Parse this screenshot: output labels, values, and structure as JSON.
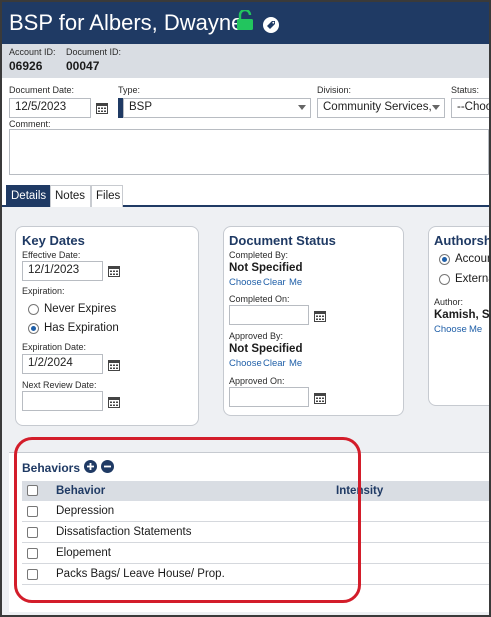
{
  "header": {
    "title": "BSP for Albers, Dwayne",
    "account_id_label": "Account ID:",
    "account_id": "06926",
    "document_id_label": "Document ID:",
    "document_id": "00047",
    "lock_color": "#22c55e"
  },
  "form": {
    "document_date_label": "Document Date:",
    "document_date": "12/5/2023",
    "type_label": "Type:",
    "type_value": "BSP",
    "division_label": "Division:",
    "division_value": "Community Services,",
    "status_label": "Status:",
    "status_value": "--Choo",
    "comment_label": "Comment:"
  },
  "tabs": [
    {
      "label": "Details",
      "active": true
    },
    {
      "label": "Notes",
      "active": false
    },
    {
      "label": "Files",
      "active": false
    }
  ],
  "key_dates": {
    "title": "Key Dates",
    "effective_label": "Effective Date:",
    "effective_value": "12/1/2023",
    "expiration_label": "Expiration:",
    "never_expires": "Never Expires",
    "has_expiration": "Has Expiration",
    "expiration_date_label": "Expiration Date:",
    "expiration_date_value": "1/2/2024",
    "next_review_label": "Next Review Date:"
  },
  "document_status": {
    "title": "Document Status",
    "completed_by_label": "Completed By:",
    "completed_by_value": "Not Specified",
    "completed_links": [
      "Choose",
      "Clear",
      "Me"
    ],
    "completed_on_label": "Completed On:",
    "approved_by_label": "Approved By:",
    "approved_by_value": "Not Specified",
    "approved_links": [
      "Choose",
      "Clear",
      "Me"
    ],
    "approved_on_label": "Approved On:"
  },
  "authorship": {
    "title": "Authorshi",
    "option1": "Accoun",
    "option2": "Externa",
    "author_label": "Author:",
    "author_value": "Kamish, Sc",
    "links": [
      "Choose",
      "Me"
    ]
  },
  "behaviors": {
    "title": "Behaviors",
    "col_behavior": "Behavior",
    "col_intensity": "Intensity",
    "rows": [
      "Depression",
      "Dissatisfaction Statements",
      "Elopement",
      "Packs Bags/ Leave House/ Prop."
    ],
    "highlight_color": "#d31d2a"
  }
}
